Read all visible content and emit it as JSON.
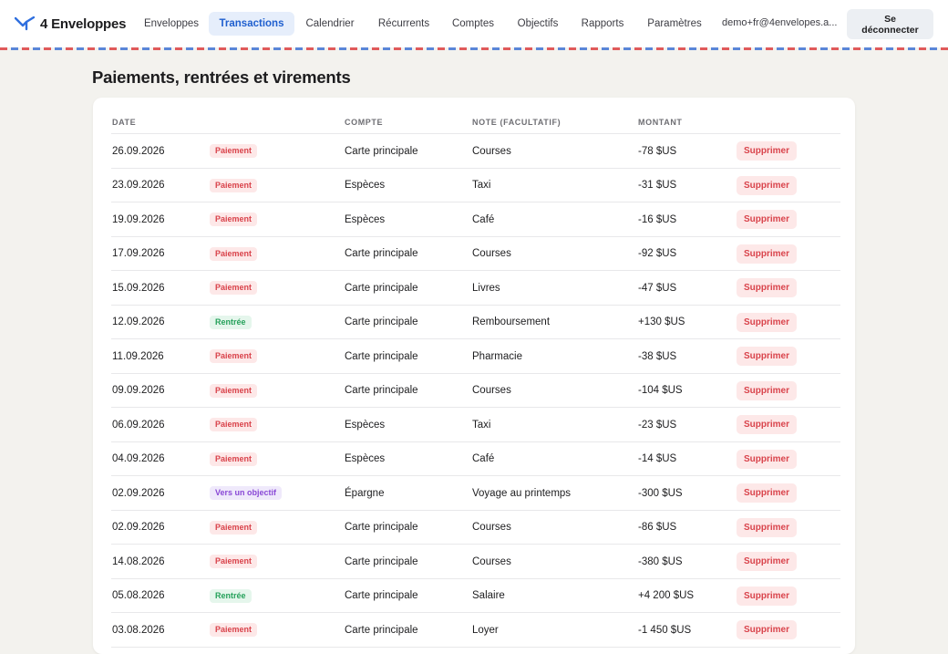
{
  "app": {
    "name": "4 Enveloppes"
  },
  "nav": [
    {
      "label": "Enveloppes",
      "name": "nav-enveloppes"
    },
    {
      "label": "Transactions",
      "name": "nav-transactions",
      "active": true
    },
    {
      "label": "Calendrier",
      "name": "nav-calendrier"
    },
    {
      "label": "Récurrents",
      "name": "nav-recurrents"
    },
    {
      "label": "Comptes",
      "name": "nav-comptes"
    },
    {
      "label": "Objectifs",
      "name": "nav-objectifs"
    },
    {
      "label": "Rapports",
      "name": "nav-rapports"
    },
    {
      "label": "Paramètres",
      "name": "nav-parametres"
    }
  ],
  "user": {
    "email": "demo+fr@4envelopes.a...",
    "logout_label": "Se déconnecter"
  },
  "page": {
    "title": "Paiements, rentrées et virements"
  },
  "table": {
    "headers": {
      "date": "DATE",
      "account": "COMPTE",
      "note": "NOTE (FACULTATIF)",
      "amount": "MONTANT"
    },
    "delete_label": "Supprimer",
    "rows": [
      {
        "date": "26.09.2026",
        "type": "Paiement",
        "kind": "payment",
        "account": "Carte principale",
        "note": "Courses",
        "amount": "-78 $US"
      },
      {
        "date": "23.09.2026",
        "type": "Paiement",
        "kind": "payment",
        "account": "Espèces",
        "note": "Taxi",
        "amount": "-31 $US"
      },
      {
        "date": "19.09.2026",
        "type": "Paiement",
        "kind": "payment",
        "account": "Espèces",
        "note": "Café",
        "amount": "-16 $US"
      },
      {
        "date": "17.09.2026",
        "type": "Paiement",
        "kind": "payment",
        "account": "Carte principale",
        "note": "Courses",
        "amount": "-92 $US"
      },
      {
        "date": "15.09.2026",
        "type": "Paiement",
        "kind": "payment",
        "account": "Carte principale",
        "note": "Livres",
        "amount": "-47 $US"
      },
      {
        "date": "12.09.2026",
        "type": "Rentrée",
        "kind": "income",
        "account": "Carte principale",
        "note": "Remboursement",
        "amount": "+130 $US"
      },
      {
        "date": "11.09.2026",
        "type": "Paiement",
        "kind": "payment",
        "account": "Carte principale",
        "note": "Pharmacie",
        "amount": "-38 $US"
      },
      {
        "date": "09.09.2026",
        "type": "Paiement",
        "kind": "payment",
        "account": "Carte principale",
        "note": "Courses",
        "amount": "-104 $US"
      },
      {
        "date": "06.09.2026",
        "type": "Paiement",
        "kind": "payment",
        "account": "Espèces",
        "note": "Taxi",
        "amount": "-23 $US"
      },
      {
        "date": "04.09.2026",
        "type": "Paiement",
        "kind": "payment",
        "account": "Espèces",
        "note": "Café",
        "amount": "-14 $US"
      },
      {
        "date": "02.09.2026",
        "type": "Vers un objectif",
        "kind": "goal",
        "account": "Épargne",
        "note": "Voyage au printemps",
        "amount": "-300 $US"
      },
      {
        "date": "02.09.2026",
        "type": "Paiement",
        "kind": "payment",
        "account": "Carte principale",
        "note": "Courses",
        "amount": "-86 $US"
      },
      {
        "date": "14.08.2026",
        "type": "Paiement",
        "kind": "payment",
        "account": "Carte principale",
        "note": "Courses",
        "amount": "-380 $US"
      },
      {
        "date": "05.08.2026",
        "type": "Rentrée",
        "kind": "income",
        "account": "Carte principale",
        "note": "Salaire",
        "amount": "+4 200 $US"
      },
      {
        "date": "03.08.2026",
        "type": "Paiement",
        "kind": "payment",
        "account": "Carte principale",
        "note": "Loyer",
        "amount": "-1 450 $US"
      }
    ]
  },
  "colors": {
    "accent": "#1f5fcf",
    "payment": "#d9434b",
    "income": "#26a15b",
    "goal": "#8a4ad6"
  }
}
